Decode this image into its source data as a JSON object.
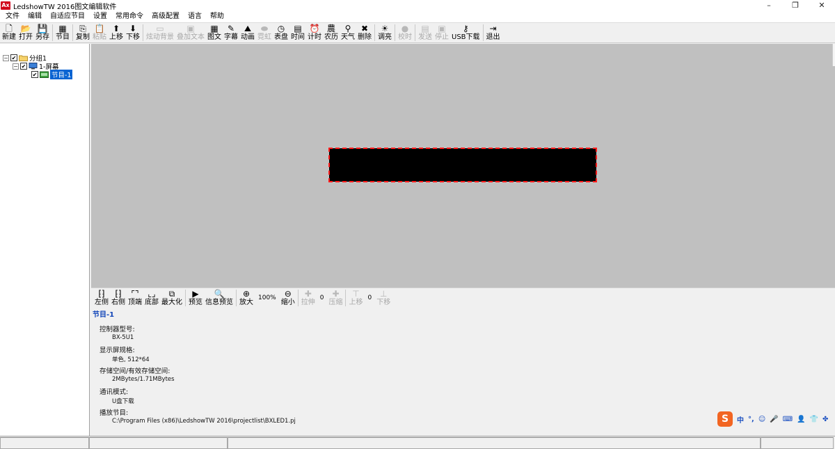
{
  "window": {
    "app_icon_text": "Ax",
    "title": "LedshowTW 2016图文编辑软件",
    "controls": [
      "–",
      "❐",
      "✕"
    ]
  },
  "menu": [
    "文件",
    "编辑",
    "自适应节目",
    "设置",
    "常用命令",
    "高级配置",
    "语言",
    "帮助"
  ],
  "toolbar": [
    {
      "label": "新建",
      "icon": "🗋",
      "enabled": true,
      "icon_name": "new-file-icon"
    },
    {
      "label": "打开",
      "icon": "📂",
      "enabled": true,
      "icon_name": "open-folder-icon"
    },
    {
      "label": "另存",
      "icon": "💾",
      "enabled": true,
      "icon_name": "save-icon"
    },
    {
      "sep": true
    },
    {
      "label": "节目",
      "icon": "▦",
      "enabled": true,
      "icon_name": "program-icon"
    },
    {
      "sep": true
    },
    {
      "label": "复制",
      "icon": "⎘",
      "enabled": true,
      "icon_name": "copy-icon"
    },
    {
      "label": "粘贴",
      "icon": "📋",
      "enabled": false,
      "icon_name": "paste-icon"
    },
    {
      "label": "上移",
      "icon": "⬆",
      "enabled": true,
      "icon_name": "move-up-icon"
    },
    {
      "label": "下移",
      "icon": "⬇",
      "enabled": true,
      "icon_name": "move-down-icon"
    },
    {
      "sep": true
    },
    {
      "label": "炫动背景",
      "icon": "▭",
      "enabled": false,
      "icon_name": "dynamic-background-icon"
    },
    {
      "label": "叠加文本",
      "icon": "▣",
      "enabled": false,
      "icon_name": "overlay-text-icon"
    },
    {
      "label": "图文",
      "icon": "▦",
      "enabled": true,
      "icon_name": "image-text-icon"
    },
    {
      "label": "字幕",
      "icon": "✎",
      "enabled": true,
      "icon_name": "subtitle-icon"
    },
    {
      "label": "动画",
      "icon": "⛰",
      "enabled": true,
      "icon_name": "animation-icon"
    },
    {
      "label": "霓虹",
      "icon": "⬬",
      "enabled": false,
      "icon_name": "neon-icon"
    },
    {
      "label": "表盘",
      "icon": "◷",
      "enabled": true,
      "icon_name": "clock-dial-icon"
    },
    {
      "label": "时间",
      "icon": "▤",
      "enabled": true,
      "icon_name": "time-icon"
    },
    {
      "label": "计时",
      "icon": "⏰",
      "enabled": true,
      "icon_name": "timer-icon"
    },
    {
      "label": "农历",
      "icon": "農",
      "enabled": true,
      "icon_name": "lunar-calendar-icon"
    },
    {
      "label": "天气",
      "icon": "⚲",
      "enabled": true,
      "icon_name": "weather-icon"
    },
    {
      "label": "删除",
      "icon": "✖",
      "enabled": true,
      "icon_name": "delete-icon"
    },
    {
      "sep": true
    },
    {
      "label": "调亮",
      "icon": "☀",
      "enabled": true,
      "icon_name": "brightness-icon"
    },
    {
      "sep": true
    },
    {
      "label": "校时",
      "icon": "●",
      "enabled": false,
      "icon_name": "time-sync-icon"
    },
    {
      "sep": true
    },
    {
      "label": "发送",
      "icon": "▤",
      "enabled": false,
      "icon_name": "send-icon"
    },
    {
      "label": "停止",
      "icon": "▣",
      "enabled": false,
      "icon_name": "stop-icon"
    },
    {
      "label": "USB下载",
      "icon": "⚷",
      "enabled": true,
      "icon_name": "usb-download-icon"
    },
    {
      "sep": true
    },
    {
      "label": "退出",
      "icon": "⇥",
      "enabled": true,
      "icon_name": "exit-icon"
    }
  ],
  "tree": {
    "group": "分组1",
    "screen": "1-屏幕",
    "program": "节目-1"
  },
  "bottom_toolbar": [
    {
      "label": "左侧",
      "icon": "⁅⁆",
      "enabled": true,
      "icon_name": "align-left-icon"
    },
    {
      "label": "右侧",
      "icon": "⁅⁆",
      "enabled": true,
      "icon_name": "align-right-icon"
    },
    {
      "label": "顶端",
      "icon": "⌜⌝",
      "enabled": true,
      "icon_name": "align-top-icon"
    },
    {
      "label": "底部",
      "icon": "⌞⌟",
      "enabled": true,
      "icon_name": "align-bottom-icon"
    },
    {
      "label": "最大化",
      "icon": "⧉",
      "enabled": true,
      "icon_name": "maximize-icon"
    },
    {
      "sep": true
    },
    {
      "label": "预览",
      "icon": "▶",
      "enabled": true,
      "icon_name": "preview-icon"
    },
    {
      "label": "信息预览",
      "icon": "🔍",
      "enabled": true,
      "icon_name": "info-preview-icon"
    },
    {
      "sep": true
    },
    {
      "label": "放大",
      "icon": "⊕",
      "enabled": true,
      "icon_name": "zoom-in-icon"
    },
    {
      "value": "100%"
    },
    {
      "label": "缩小",
      "icon": "⊖",
      "enabled": true,
      "icon_name": "zoom-out-icon"
    },
    {
      "sep": true
    },
    {
      "label": "拉伸",
      "icon": "✚",
      "enabled": false,
      "icon_name": "stretch-icon"
    },
    {
      "value": "0"
    },
    {
      "label": "压缩",
      "icon": "✚",
      "enabled": false,
      "icon_name": "compress-icon"
    },
    {
      "sep": true
    },
    {
      "label": "上移",
      "icon": "⊤",
      "enabled": false,
      "icon_name": "shift-up-icon"
    },
    {
      "value": "0"
    },
    {
      "label": "下移",
      "icon": "⊥",
      "enabled": false,
      "icon_name": "shift-down-icon"
    }
  ],
  "info": {
    "title": "节目-1",
    "fields": [
      {
        "label": "控制器型号:",
        "value": "BX-5U1"
      },
      {
        "label": "显示屏规格:",
        "value": "单色, 512*64"
      },
      {
        "label": "存储空间/有效存储空间:",
        "value": "2MBytes/1.71MBytes"
      },
      {
        "label": "通讯模式:",
        "value": "U盘下载"
      },
      {
        "label": "播放节目:",
        "value": "C:\\Program Files (x86)\\LedshowTW 2016\\projectlist\\BXLED1.pj"
      }
    ]
  },
  "ime": {
    "logo": "S",
    "items": [
      "中",
      "°,",
      "☺",
      "🎤",
      "⌨",
      "👤",
      "👕",
      "✤"
    ]
  },
  "colors": {
    "led_background": "#000000",
    "led_border": "#ff1a1a",
    "canvas": "#c0c0c0",
    "selection": "#0a64d2",
    "info_title": "#1044b8",
    "ime_brand": "#f26522"
  }
}
